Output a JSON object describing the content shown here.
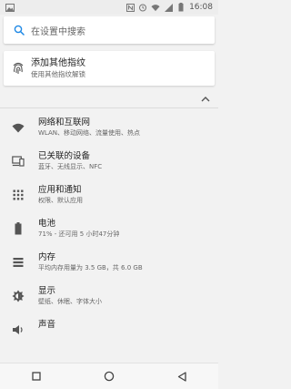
{
  "status_bar": {
    "time": "16:08",
    "icons": [
      "image-icon",
      "n-icon",
      "alarm-icon",
      "wifi-icon",
      "signal-icon",
      "battery-icon"
    ]
  },
  "search": {
    "placeholder": "在设置中搜索"
  },
  "suggestion": {
    "title": "添加其他指纹",
    "subtitle": "使用其他指纹解锁"
  },
  "settings": {
    "items": [
      {
        "icon": "wifi-icon",
        "title": "网络和互联网",
        "subtitle": "WLAN、移动网络、流量使用、热点"
      },
      {
        "icon": "connected-devices-icon",
        "title": "已关联的设备",
        "subtitle": "蓝牙、无线显示、NFC"
      },
      {
        "icon": "apps-icon",
        "title": "应用和通知",
        "subtitle": "权限、默认应用"
      },
      {
        "icon": "battery-icon",
        "title": "电池",
        "subtitle": "71% - 还可用 5 小时47分钟"
      },
      {
        "icon": "storage-icon",
        "title": "内存",
        "subtitle": "平均内存用量为 3.5 GB，共 6.0 GB"
      },
      {
        "icon": "display-icon",
        "title": "显示",
        "subtitle": "壁纸、休眠、字体大小"
      },
      {
        "icon": "sound-icon",
        "title": "声音",
        "subtitle": ""
      }
    ]
  },
  "colors": {
    "accent": "#1e88e5",
    "icon": "#555555"
  }
}
